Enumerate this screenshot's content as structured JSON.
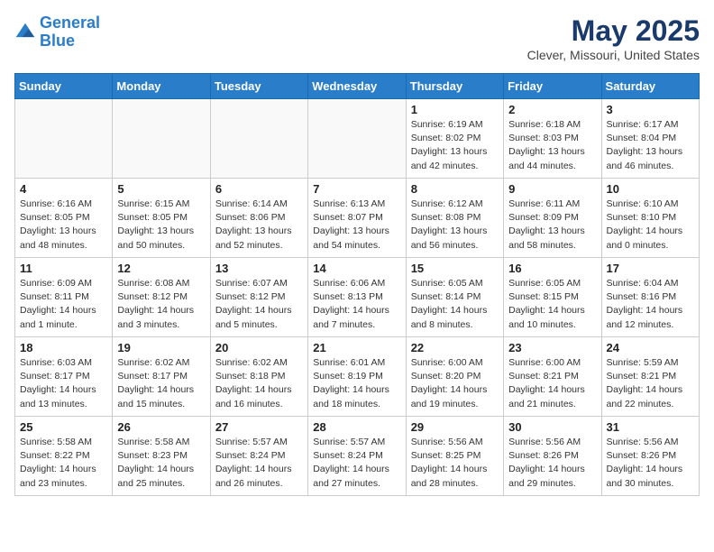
{
  "header": {
    "logo_line1": "General",
    "logo_line2": "Blue",
    "month_title": "May 2025",
    "location": "Clever, Missouri, United States"
  },
  "weekdays": [
    "Sunday",
    "Monday",
    "Tuesday",
    "Wednesday",
    "Thursday",
    "Friday",
    "Saturday"
  ],
  "weeks": [
    [
      {
        "day": "",
        "info": ""
      },
      {
        "day": "",
        "info": ""
      },
      {
        "day": "",
        "info": ""
      },
      {
        "day": "",
        "info": ""
      },
      {
        "day": "1",
        "info": "Sunrise: 6:19 AM\nSunset: 8:02 PM\nDaylight: 13 hours\nand 42 minutes."
      },
      {
        "day": "2",
        "info": "Sunrise: 6:18 AM\nSunset: 8:03 PM\nDaylight: 13 hours\nand 44 minutes."
      },
      {
        "day": "3",
        "info": "Sunrise: 6:17 AM\nSunset: 8:04 PM\nDaylight: 13 hours\nand 46 minutes."
      }
    ],
    [
      {
        "day": "4",
        "info": "Sunrise: 6:16 AM\nSunset: 8:05 PM\nDaylight: 13 hours\nand 48 minutes."
      },
      {
        "day": "5",
        "info": "Sunrise: 6:15 AM\nSunset: 8:05 PM\nDaylight: 13 hours\nand 50 minutes."
      },
      {
        "day": "6",
        "info": "Sunrise: 6:14 AM\nSunset: 8:06 PM\nDaylight: 13 hours\nand 52 minutes."
      },
      {
        "day": "7",
        "info": "Sunrise: 6:13 AM\nSunset: 8:07 PM\nDaylight: 13 hours\nand 54 minutes."
      },
      {
        "day": "8",
        "info": "Sunrise: 6:12 AM\nSunset: 8:08 PM\nDaylight: 13 hours\nand 56 minutes."
      },
      {
        "day": "9",
        "info": "Sunrise: 6:11 AM\nSunset: 8:09 PM\nDaylight: 13 hours\nand 58 minutes."
      },
      {
        "day": "10",
        "info": "Sunrise: 6:10 AM\nSunset: 8:10 PM\nDaylight: 14 hours\nand 0 minutes."
      }
    ],
    [
      {
        "day": "11",
        "info": "Sunrise: 6:09 AM\nSunset: 8:11 PM\nDaylight: 14 hours\nand 1 minute."
      },
      {
        "day": "12",
        "info": "Sunrise: 6:08 AM\nSunset: 8:12 PM\nDaylight: 14 hours\nand 3 minutes."
      },
      {
        "day": "13",
        "info": "Sunrise: 6:07 AM\nSunset: 8:12 PM\nDaylight: 14 hours\nand 5 minutes."
      },
      {
        "day": "14",
        "info": "Sunrise: 6:06 AM\nSunset: 8:13 PM\nDaylight: 14 hours\nand 7 minutes."
      },
      {
        "day": "15",
        "info": "Sunrise: 6:05 AM\nSunset: 8:14 PM\nDaylight: 14 hours\nand 8 minutes."
      },
      {
        "day": "16",
        "info": "Sunrise: 6:05 AM\nSunset: 8:15 PM\nDaylight: 14 hours\nand 10 minutes."
      },
      {
        "day": "17",
        "info": "Sunrise: 6:04 AM\nSunset: 8:16 PM\nDaylight: 14 hours\nand 12 minutes."
      }
    ],
    [
      {
        "day": "18",
        "info": "Sunrise: 6:03 AM\nSunset: 8:17 PM\nDaylight: 14 hours\nand 13 minutes."
      },
      {
        "day": "19",
        "info": "Sunrise: 6:02 AM\nSunset: 8:17 PM\nDaylight: 14 hours\nand 15 minutes."
      },
      {
        "day": "20",
        "info": "Sunrise: 6:02 AM\nSunset: 8:18 PM\nDaylight: 14 hours\nand 16 minutes."
      },
      {
        "day": "21",
        "info": "Sunrise: 6:01 AM\nSunset: 8:19 PM\nDaylight: 14 hours\nand 18 minutes."
      },
      {
        "day": "22",
        "info": "Sunrise: 6:00 AM\nSunset: 8:20 PM\nDaylight: 14 hours\nand 19 minutes."
      },
      {
        "day": "23",
        "info": "Sunrise: 6:00 AM\nSunset: 8:21 PM\nDaylight: 14 hours\nand 21 minutes."
      },
      {
        "day": "24",
        "info": "Sunrise: 5:59 AM\nSunset: 8:21 PM\nDaylight: 14 hours\nand 22 minutes."
      }
    ],
    [
      {
        "day": "25",
        "info": "Sunrise: 5:58 AM\nSunset: 8:22 PM\nDaylight: 14 hours\nand 23 minutes."
      },
      {
        "day": "26",
        "info": "Sunrise: 5:58 AM\nSunset: 8:23 PM\nDaylight: 14 hours\nand 25 minutes."
      },
      {
        "day": "27",
        "info": "Sunrise: 5:57 AM\nSunset: 8:24 PM\nDaylight: 14 hours\nand 26 minutes."
      },
      {
        "day": "28",
        "info": "Sunrise: 5:57 AM\nSunset: 8:24 PM\nDaylight: 14 hours\nand 27 minutes."
      },
      {
        "day": "29",
        "info": "Sunrise: 5:56 AM\nSunset: 8:25 PM\nDaylight: 14 hours\nand 28 minutes."
      },
      {
        "day": "30",
        "info": "Sunrise: 5:56 AM\nSunset: 8:26 PM\nDaylight: 14 hours\nand 29 minutes."
      },
      {
        "day": "31",
        "info": "Sunrise: 5:56 AM\nSunset: 8:26 PM\nDaylight: 14 hours\nand 30 minutes."
      }
    ]
  ]
}
